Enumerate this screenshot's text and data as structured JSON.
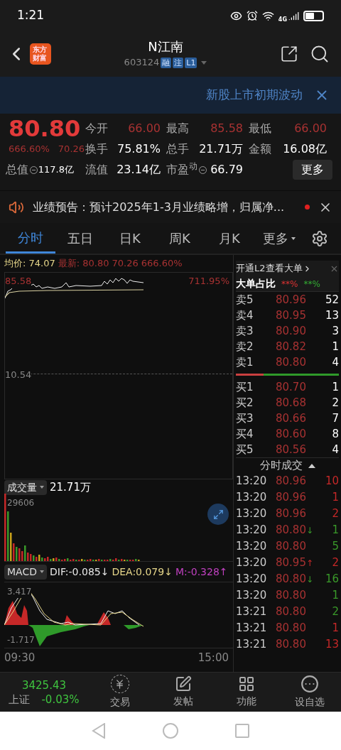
{
  "status_bar": {
    "time": "1:21",
    "network": "4G"
  },
  "header": {
    "logo": "东方财富",
    "title": "N江南",
    "code": "603124",
    "tags": [
      "融",
      "注",
      "L1"
    ]
  },
  "notice_banner": {
    "text": "新股上市初期波动"
  },
  "quote": {
    "price": "80.80",
    "change_pct": "666.60%",
    "change": "70.26",
    "stats": [
      {
        "label": "今开",
        "value": "66.00",
        "kind": "price",
        "info": false
      },
      {
        "label": "最高",
        "value": "85.58",
        "kind": "price",
        "info": false
      },
      {
        "label": "最低",
        "value": "66.00",
        "kind": "price",
        "info": false
      },
      {
        "label": "换手",
        "value": "75.81%",
        "kind": "plain",
        "info": false
      },
      {
        "label": "总手",
        "value": "21.71万",
        "kind": "plain",
        "info": false
      },
      {
        "label": "金额",
        "value": "16.08亿",
        "kind": "plain",
        "info": false
      },
      {
        "label": "总值",
        "value": "117.8亿",
        "kind": "small",
        "info": true
      },
      {
        "label": "流值",
        "value": "23.14亿",
        "kind": "plain",
        "info": false
      },
      {
        "label": "市盈$^{动}$",
        "value": "66.79",
        "kind": "plain",
        "info": true
      }
    ],
    "more_button": "更多"
  },
  "announcement": {
    "text": "业绩预告：预计2025年1-3月业绩略增，归属净...",
    "unread": true
  },
  "tabs": [
    {
      "label": "分时",
      "selected": true,
      "dropdown": false
    },
    {
      "label": "五日",
      "selected": false,
      "dropdown": false
    },
    {
      "label": "日K",
      "selected": false,
      "dropdown": false
    },
    {
      "label": "周K",
      "selected": false,
      "dropdown": false
    },
    {
      "label": "月K",
      "selected": false,
      "dropdown": false
    },
    {
      "label": "更多",
      "selected": false,
      "dropdown": true
    }
  ],
  "price_chart": {
    "avg_label": "均价:",
    "avg": "74.07",
    "latest_label": "最新:",
    "latest": "80.80",
    "change": "70.26",
    "change_pct": "666.60%",
    "high": "85.58",
    "high_pct": "711.95%",
    "base": "10.54"
  },
  "volume_chart": {
    "label": "成交量",
    "total": "21.71万",
    "max": "29606"
  },
  "macd_chart": {
    "label": "MACD",
    "indicators": [
      {
        "text": "DIF:-0.085↓",
        "color": "#e8e8e8"
      },
      {
        "text": "DEA:0.079↓",
        "color": "#e6d68a"
      },
      {
        "text": "M:-0.328↑",
        "color": "#c040c0"
      }
    ],
    "max": "3.417",
    "min": "-1.717"
  },
  "time_axis": {
    "start": "09:30",
    "end": "15:00"
  },
  "order_book": {
    "l2_link": "开通L2查看大单",
    "big_order_label": "大单占比",
    "big_buy": "**%",
    "big_sell": "**%",
    "ratio_bar": {
      "level": 0.27
    },
    "asks": [
      {
        "label": "卖5",
        "price": "80.96",
        "volume": "52"
      },
      {
        "label": "卖4",
        "price": "80.95",
        "volume": "13"
      },
      {
        "label": "卖3",
        "price": "80.90",
        "volume": "3"
      },
      {
        "label": "卖2",
        "price": "80.82",
        "volume": "1"
      },
      {
        "label": "卖1",
        "price": "80.80",
        "volume": "4"
      }
    ],
    "bids": [
      {
        "label": "买1",
        "price": "80.70",
        "volume": "1"
      },
      {
        "label": "买2",
        "price": "80.68",
        "volume": "2"
      },
      {
        "label": "买3",
        "price": "80.66",
        "volume": "7"
      },
      {
        "label": "买4",
        "price": "80.60",
        "volume": "8"
      },
      {
        "label": "买5",
        "price": "80.56",
        "volume": "4"
      }
    ]
  },
  "trades": {
    "title": "分时成交",
    "rows": [
      {
        "time": "13:20",
        "price": "80.96",
        "volume": "10",
        "color": "#c62828"
      },
      {
        "time": "13:20",
        "price": "80.96",
        "volume": "1",
        "color": "#c62828"
      },
      {
        "time": "13:20",
        "price": "80.96",
        "volume": "2",
        "color": "#c62828"
      },
      {
        "time": "13:20",
        "price": "80.80",
        "arrow": "↓",
        "volume": "1",
        "color": "#3a9a2a"
      },
      {
        "time": "13:20",
        "price": "80.80",
        "volume": "5",
        "color": "#3a9a2a"
      },
      {
        "time": "13:20",
        "price": "80.95",
        "arrow": "↑",
        "volume": "2",
        "color": "#c62828"
      },
      {
        "time": "13:20",
        "price": "80.80",
        "arrow": "↓",
        "volume": "16",
        "color": "#3a9a2a"
      },
      {
        "time": "13:20",
        "price": "80.80",
        "volume": "1",
        "color": "#3a9a2a"
      },
      {
        "time": "13:21",
        "price": "80.80",
        "volume": "2",
        "color": "#3a9a2a"
      },
      {
        "time": "13:21",
        "price": "80.80",
        "volume": "1",
        "color": "#c62828"
      },
      {
        "time": "13:21",
        "price": "80.80",
        "volume": "13",
        "color": "#c62828"
      }
    ]
  },
  "bottom_bar": {
    "index": {
      "value": "3425.43",
      "name": "上证",
      "change": "-0.03%"
    },
    "items": [
      {
        "label": "交易",
        "kind": "trade"
      },
      {
        "label": "发帖",
        "kind": "post"
      },
      {
        "label": "功能",
        "kind": "functions"
      },
      {
        "label": "设自选",
        "kind": "watchlist"
      }
    ]
  }
}
